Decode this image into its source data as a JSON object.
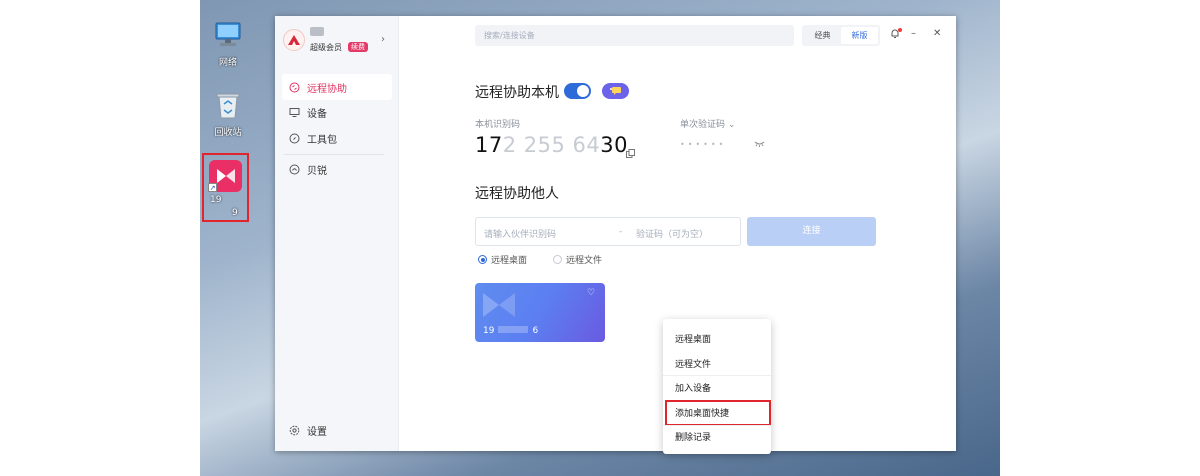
{
  "desktop": {
    "icons": [
      {
        "name": "network",
        "label": "网络"
      },
      {
        "name": "recycle-bin",
        "label": "回收站"
      }
    ],
    "app_shortcut": {
      "label_line1": "19",
      "label_line2": "9"
    }
  },
  "sidebar": {
    "member_label": "超级会员",
    "renew_label": "续费",
    "items": [
      {
        "label": "远程协助",
        "icon": "remote-assist-icon",
        "active": true
      },
      {
        "label": "设备",
        "icon": "monitor-icon",
        "active": false
      },
      {
        "label": "工具包",
        "icon": "compass-icon",
        "active": false
      },
      {
        "label": "贝锐",
        "icon": "brand-icon",
        "active": false
      }
    ],
    "settings_label": "设置"
  },
  "topbar": {
    "search_placeholder": "搜索/连接设备",
    "mode_classic": "经典",
    "mode_new": "新版",
    "active_mode": "新版"
  },
  "local": {
    "title": "远程协助本机",
    "toggle_on": true,
    "id_label": "本机识别码",
    "id_prefix": "17",
    "id_blurred": "2 255 64",
    "id_suffix": "30",
    "code_label": "单次验证码",
    "code_masked": "••••••"
  },
  "remote": {
    "title": "远程协助他人",
    "partner_placeholder": "请输入伙伴识别码",
    "separator": "-",
    "code_placeholder": "验证码（可为空）",
    "connect_label": "连接",
    "radio_options": [
      {
        "label": "远程桌面",
        "selected": true
      },
      {
        "label": "远程文件",
        "selected": false
      }
    ]
  },
  "device_card": {
    "number_prefix": "19",
    "number_suffix": "6"
  },
  "context_menu": {
    "items": [
      "远程桌面",
      "远程文件",
      "加入设备",
      "添加桌面快捷",
      "删除记录"
    ],
    "highlighted": "添加桌面快捷"
  },
  "colors": {
    "accent": "#2f6ad9",
    "brand": "#ea2f66",
    "highlight_border": "#e0262c"
  }
}
